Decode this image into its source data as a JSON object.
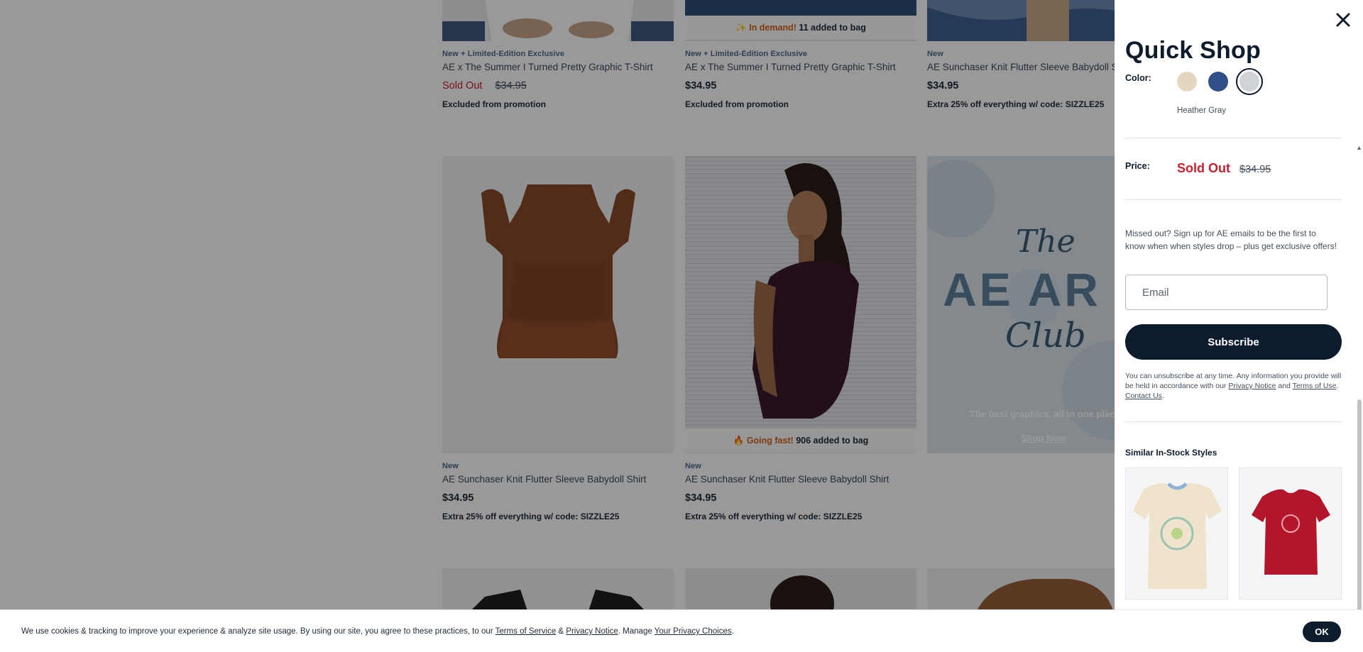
{
  "products": [
    {
      "badge": "New + Limited-Edition Exclusive",
      "name": "AE x The Summer I Turned Pretty Graphic T-Shirt",
      "sold_out": "Sold Out",
      "price": "$34.95",
      "promo": "Excluded from promotion"
    },
    {
      "badge": "New + Limited-Edition Exclusive",
      "name": "AE x The Summer I Turned Pretty Graphic T-Shirt",
      "price": "$34.95",
      "promo": "Excluded from promotion",
      "demand_label": "In demand!",
      "demand_count": "11 added to bag"
    },
    {
      "badge": "New",
      "name": "AE Sunchaser Knit Flutter Sleeve Babydoll Shirt",
      "price": "$34.95",
      "promo": "Extra 25% off everything w/ code: SIZZLE25"
    },
    {
      "badge": "New",
      "name": "AE Sunchaser Knit Flutter Sleeve Babydoll Shirt",
      "price": "$34.95",
      "promo": "Extra 25% off everything w/ code: SIZZLE25"
    },
    {
      "badge": "New",
      "name": "AE Sunchaser Knit Flutter Sleeve Babydoll Shirt",
      "price": "$34.95",
      "promo": "Extra 25% off everything w/ code: SIZZLE25",
      "demand_label": "Going fast!",
      "demand_count": "906 added to bag"
    }
  ],
  "promo_tile": {
    "title_line1": "The",
    "title_line2": "AE AR",
    "title_line3": "Club",
    "tagline": "The best graphics, all in one place",
    "cta": "Shop Now"
  },
  "quick_shop": {
    "title": "Quick Shop",
    "color_label": "Color:",
    "swatches": [
      {
        "name": "cream",
        "color": "#e6d5c0"
      },
      {
        "name": "navy",
        "color": "#2f4f86"
      },
      {
        "name": "heather gray",
        "color": "#cfd2d6"
      }
    ],
    "selected_color": "Heather Gray",
    "price_label": "Price:",
    "sold_out": "Sold Out",
    "original_price": "$34.95",
    "missed_text": "Missed out? Sign up for AE emails to be the first to know when when styles drop – plus get exclusive offers!",
    "email_placeholder": "Email",
    "subscribe_label": "Subscribe",
    "legal_prefix": "You can unsubscribe at any time. Any information you provide will be held in accordance with our ",
    "privacy_link": "Privacy Notice",
    "legal_and": " and ",
    "terms_link": "Terms of Use",
    "legal_dot": ". ",
    "contact_link": "Contact Us",
    "legal_end": ".",
    "similar_title": "Similar In-Stock Styles"
  },
  "cookie": {
    "text_prefix": "We use cookies & tracking to improve your experience & analyze site usage. By using our site, you agree to these practices, to our ",
    "terms_link": "Terms of Service",
    "amp": " & ",
    "privacy_link": "Privacy Notice",
    "manage": ". Manage ",
    "choices_link": "Your Privacy Choices",
    "end": ".",
    "ok_label": "OK"
  },
  "colors": {
    "brand_navy": "#0c1c2c",
    "sold_out_red": "#c8202e",
    "hot_orange": "#d5641a"
  },
  "icons": [
    "close-icon",
    "sparkle-icon",
    "flame-icon",
    "chevron-up-icon"
  ]
}
